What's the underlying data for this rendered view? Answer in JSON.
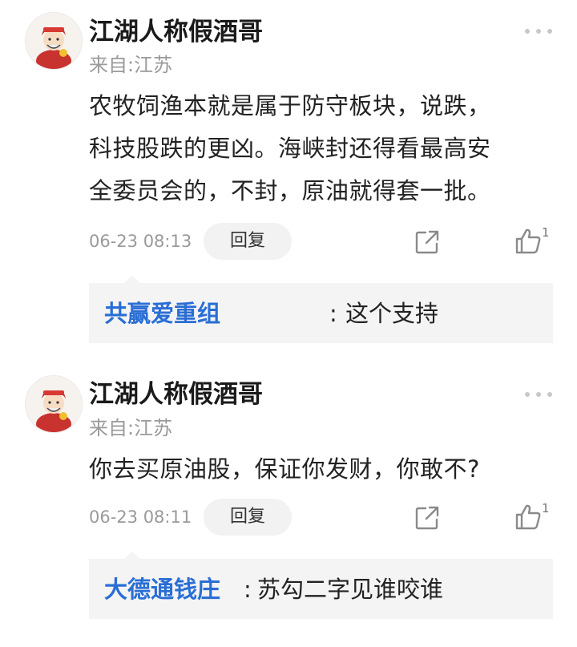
{
  "comments": [
    {
      "username": "江湖人称假酒哥",
      "location": "来自:江苏",
      "text_lines": [
        "农牧饲渔本就是属于防守板块，说跌，",
        "科技股跌的更凶。海峡封还得看最高安",
        "全委员会的，不封，原油就得套一批。"
      ],
      "timestamp": "06-23 08:13",
      "reply_label": "回复",
      "like_count": "1",
      "sub_reply": {
        "author": "共赢爱重组",
        "separator": ":",
        "text": "这个支持"
      }
    },
    {
      "username": "江湖人称假酒哥",
      "location": "来自:江苏",
      "text_lines": [
        "你去买原油股，保证你发财，你敢不?"
      ],
      "timestamp": "06-23 08:11",
      "reply_label": "回复",
      "like_count": "1",
      "sub_reply": {
        "author": "大德通钱庄",
        "separator": ":",
        "text": "苏勾二字见谁咬谁"
      }
    }
  ],
  "icons": {
    "more": "more-dots-icon",
    "share": "share-icon",
    "like": "thumbs-up-icon",
    "avatar": "avatar-caishen"
  },
  "colors": {
    "author_link": "#2a6ed5",
    "meta_gray": "#9a9a9a",
    "sub_reply_bg": "#f4f4f4"
  }
}
